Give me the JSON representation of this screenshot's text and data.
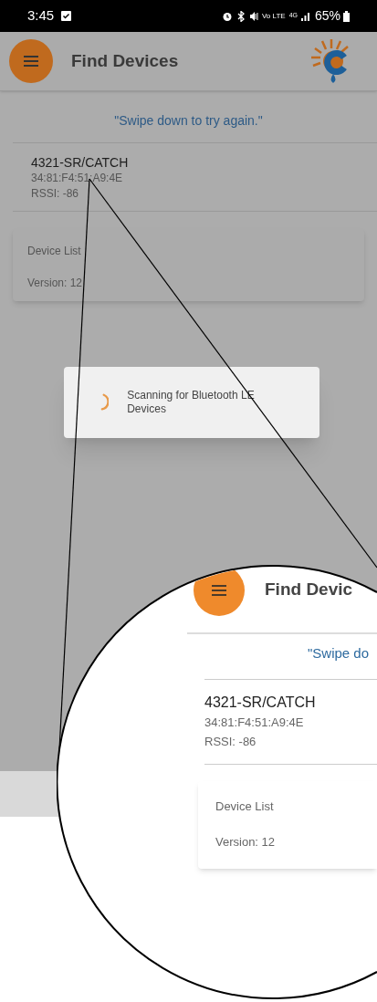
{
  "status_bar": {
    "time": "3:45",
    "volte": "Vo LTE",
    "network": "4G",
    "battery": "65%"
  },
  "header": {
    "title": "Find Devices"
  },
  "hint": "\"Swipe down to try again.\"",
  "devices": [
    {
      "name": "4321-SR/CATCH",
      "address": "34:81:F4:51:A9:4E",
      "rssi": "RSSI: -86"
    }
  ],
  "info_card": {
    "title": "Device List",
    "version": "Version: 12"
  },
  "dialog": {
    "message": "Scanning for Bluetooth LE Devices"
  },
  "magnifier": {
    "header_title": "Find Devic",
    "hint": "\"Swipe do",
    "devices": [
      {
        "name": "4321-SR/CATCH",
        "address": "34:81:F4:51:A9:4E",
        "rssi": "RSSI: -86"
      }
    ],
    "info_card": {
      "title": "Device List",
      "version": "Version: 12"
    }
  }
}
